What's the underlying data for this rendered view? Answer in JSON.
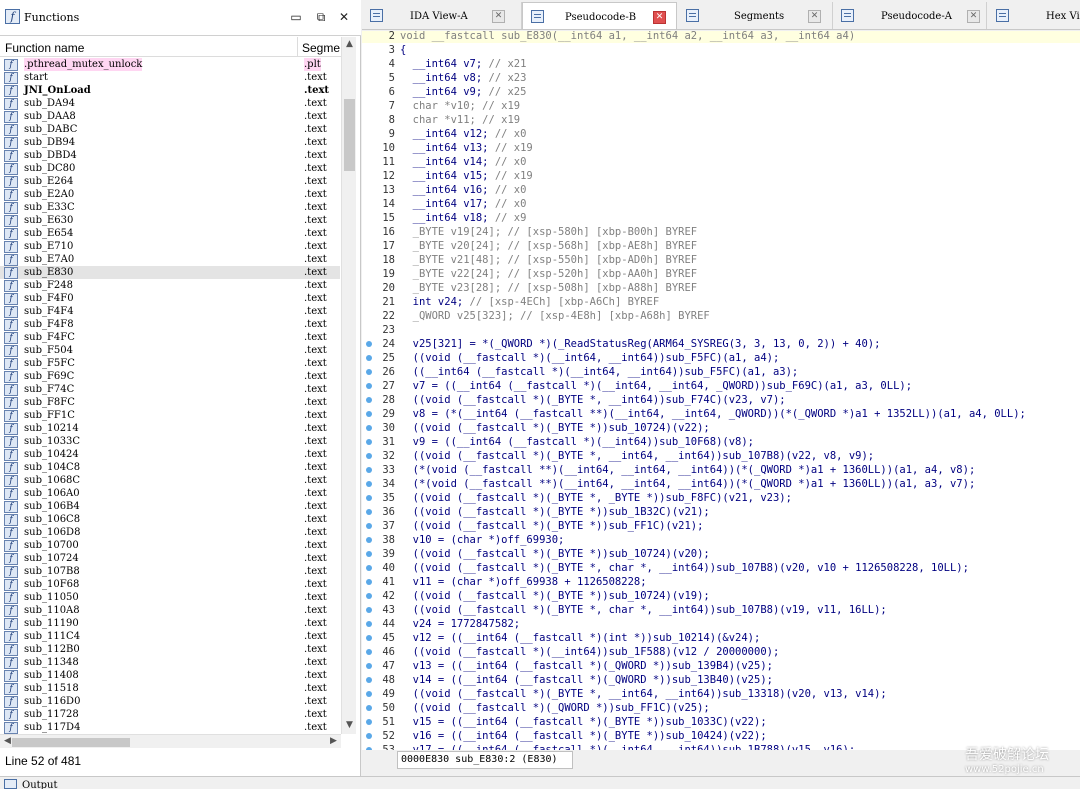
{
  "functions_panel": {
    "title": "Functions",
    "col_name": "Function name",
    "col_segment": "Segme",
    "status": "Line 52 of 481",
    "rows": [
      {
        "name": ".pthread_mutex_unlock",
        "seg": ".plt",
        "style": "pink"
      },
      {
        "name": "start",
        "seg": ".text",
        "style": ""
      },
      {
        "name": "JNI_OnLoad",
        "seg": ".text",
        "style": "bold"
      },
      {
        "name": "sub_DA94",
        "seg": ".text",
        "style": ""
      },
      {
        "name": "sub_DAA8",
        "seg": ".text",
        "style": ""
      },
      {
        "name": "sub_DABC",
        "seg": ".text",
        "style": ""
      },
      {
        "name": "sub_DB94",
        "seg": ".text",
        "style": ""
      },
      {
        "name": "sub_DBD4",
        "seg": ".text",
        "style": ""
      },
      {
        "name": "sub_DC80",
        "seg": ".text",
        "style": ""
      },
      {
        "name": "sub_E264",
        "seg": ".text",
        "style": ""
      },
      {
        "name": "sub_E2A0",
        "seg": ".text",
        "style": ""
      },
      {
        "name": "sub_E33C",
        "seg": ".text",
        "style": ""
      },
      {
        "name": "sub_E630",
        "seg": ".text",
        "style": ""
      },
      {
        "name": "sub_E654",
        "seg": ".text",
        "style": ""
      },
      {
        "name": "sub_E710",
        "seg": ".text",
        "style": ""
      },
      {
        "name": "sub_E7A0",
        "seg": ".text",
        "style": ""
      },
      {
        "name": "sub_E830",
        "seg": ".text",
        "style": "selected"
      },
      {
        "name": "sub_F248",
        "seg": ".text",
        "style": ""
      },
      {
        "name": "sub_F4F0",
        "seg": ".text",
        "style": ""
      },
      {
        "name": "sub_F4F4",
        "seg": ".text",
        "style": ""
      },
      {
        "name": "sub_F4F8",
        "seg": ".text",
        "style": ""
      },
      {
        "name": "sub_F4FC",
        "seg": ".text",
        "style": ""
      },
      {
        "name": "sub_F504",
        "seg": ".text",
        "style": ""
      },
      {
        "name": "sub_F5FC",
        "seg": ".text",
        "style": ""
      },
      {
        "name": "sub_F69C",
        "seg": ".text",
        "style": ""
      },
      {
        "name": "sub_F74C",
        "seg": ".text",
        "style": ""
      },
      {
        "name": "sub_F8FC",
        "seg": ".text",
        "style": ""
      },
      {
        "name": "sub_FF1C",
        "seg": ".text",
        "style": ""
      },
      {
        "name": "sub_10214",
        "seg": ".text",
        "style": ""
      },
      {
        "name": "sub_1033C",
        "seg": ".text",
        "style": ""
      },
      {
        "name": "sub_10424",
        "seg": ".text",
        "style": ""
      },
      {
        "name": "sub_104C8",
        "seg": ".text",
        "style": ""
      },
      {
        "name": "sub_1068C",
        "seg": ".text",
        "style": ""
      },
      {
        "name": "sub_106A0",
        "seg": ".text",
        "style": ""
      },
      {
        "name": "sub_106B4",
        "seg": ".text",
        "style": ""
      },
      {
        "name": "sub_106C8",
        "seg": ".text",
        "style": ""
      },
      {
        "name": "sub_106D8",
        "seg": ".text",
        "style": ""
      },
      {
        "name": "sub_10700",
        "seg": ".text",
        "style": ""
      },
      {
        "name": "sub_10724",
        "seg": ".text",
        "style": ""
      },
      {
        "name": "sub_107B8",
        "seg": ".text",
        "style": ""
      },
      {
        "name": "sub_10F68",
        "seg": ".text",
        "style": ""
      },
      {
        "name": "sub_11050",
        "seg": ".text",
        "style": ""
      },
      {
        "name": "sub_110A8",
        "seg": ".text",
        "style": ""
      },
      {
        "name": "sub_11190",
        "seg": ".text",
        "style": ""
      },
      {
        "name": "sub_111C4",
        "seg": ".text",
        "style": ""
      },
      {
        "name": "sub_112B0",
        "seg": ".text",
        "style": ""
      },
      {
        "name": "sub_11348",
        "seg": ".text",
        "style": ""
      },
      {
        "name": "sub_11408",
        "seg": ".text",
        "style": ""
      },
      {
        "name": "sub_11518",
        "seg": ".text",
        "style": ""
      },
      {
        "name": "sub_116D0",
        "seg": ".text",
        "style": ""
      },
      {
        "name": "sub_11728",
        "seg": ".text",
        "style": ""
      },
      {
        "name": "sub_117D4",
        "seg": ".text",
        "style": ""
      }
    ]
  },
  "tabs": [
    {
      "label": "IDA View-A",
      "active": false
    },
    {
      "label": "Pseudocode-B",
      "active": true
    },
    {
      "label": "Segments",
      "active": false
    },
    {
      "label": "Pseudocode-A",
      "active": false
    },
    {
      "label": "Hex Vi",
      "active": false
    }
  ],
  "code": {
    "status": "0000E830 sub_E830:2 (E830)",
    "lines": [
      {
        "n": "2",
        "dot": false,
        "t": "void __fastcall sub_E830(__int64 a1, __int64 a2, __int64 a3, __int64 a4)",
        "c": ""
      },
      {
        "n": "3",
        "dot": false,
        "t": "{",
        "c": ""
      },
      {
        "n": "4",
        "dot": false,
        "t": "  __int64 v7; ",
        "c": "// x21"
      },
      {
        "n": "5",
        "dot": false,
        "t": "  __int64 v8; ",
        "c": "// x23"
      },
      {
        "n": "6",
        "dot": false,
        "t": "  __int64 v9; ",
        "c": "// x25"
      },
      {
        "n": "7",
        "dot": false,
        "t": "",
        "c": "  char *v10; // x19"
      },
      {
        "n": "8",
        "dot": false,
        "t": "",
        "c": "  char *v11; // x19"
      },
      {
        "n": "9",
        "dot": false,
        "t": "  __int64 v12; ",
        "c": "// x0"
      },
      {
        "n": "10",
        "dot": false,
        "t": "  __int64 v13; ",
        "c": "// x19"
      },
      {
        "n": "11",
        "dot": false,
        "t": "  __int64 v14; ",
        "c": "// x0"
      },
      {
        "n": "12",
        "dot": false,
        "t": "  __int64 v15; ",
        "c": "// x19"
      },
      {
        "n": "13",
        "dot": false,
        "t": "  __int64 v16; ",
        "c": "// x0"
      },
      {
        "n": "14",
        "dot": false,
        "t": "  __int64 v17; ",
        "c": "// x0"
      },
      {
        "n": "15",
        "dot": false,
        "t": "  __int64 v18; ",
        "c": "// x9"
      },
      {
        "n": "16",
        "dot": false,
        "t": "",
        "c": "  _BYTE v19[24]; // [xsp-580h] [xbp-B00h] BYREF"
      },
      {
        "n": "17",
        "dot": false,
        "t": "",
        "c": "  _BYTE v20[24]; // [xsp-568h] [xbp-AE8h] BYREF"
      },
      {
        "n": "18",
        "dot": false,
        "t": "",
        "c": "  _BYTE v21[48]; // [xsp-550h] [xbp-AD0h] BYREF"
      },
      {
        "n": "19",
        "dot": false,
        "t": "",
        "c": "  _BYTE v22[24]; // [xsp-520h] [xbp-AA0h] BYREF"
      },
      {
        "n": "20",
        "dot": false,
        "t": "",
        "c": "  _BYTE v23[28]; // [xsp-508h] [xbp-A88h] BYREF"
      },
      {
        "n": "21",
        "dot": false,
        "t": "  int v24; ",
        "c": "// [xsp-4ECh] [xbp-A6Ch] BYREF"
      },
      {
        "n": "22",
        "dot": false,
        "t": "",
        "c": "  _QWORD v25[323]; // [xsp-4E8h] [xbp-A68h] BYREF"
      },
      {
        "n": "23",
        "dot": false,
        "t": "",
        "c": ""
      },
      {
        "n": "24",
        "dot": true,
        "t": "  v25[321] = *(_QWORD *)(_ReadStatusReg(ARM64_SYSREG(3, 3, 13, 0, 2)) + 40);",
        "c": ""
      },
      {
        "n": "25",
        "dot": true,
        "t": "  ((void (__fastcall *)(__int64, __int64))sub_F5FC)(a1, a4);",
        "c": ""
      },
      {
        "n": "26",
        "dot": true,
        "t": "  ((__int64 (__fastcall *)(__int64, __int64))sub_F5FC)(a1, a3);",
        "c": ""
      },
      {
        "n": "27",
        "dot": true,
        "t": "  v7 = ((__int64 (__fastcall *)(__int64, __int64, _QWORD))sub_F69C)(a1, a3, 0LL);",
        "c": ""
      },
      {
        "n": "28",
        "dot": true,
        "t": "  ((void (__fastcall *)(_BYTE *, __int64))sub_F74C)(v23, v7);",
        "c": ""
      },
      {
        "n": "29",
        "dot": true,
        "t": "  v8 = (*(__int64 (__fastcall **)(__int64, __int64, _QWORD))(*(_QWORD *)a1 + 1352LL))(a1, a4, 0LL);",
        "c": ""
      },
      {
        "n": "30",
        "dot": true,
        "t": "  ((void (__fastcall *)(_BYTE *))sub_10724)(v22);",
        "c": ""
      },
      {
        "n": "31",
        "dot": true,
        "t": "  v9 = ((__int64 (__fastcall *)(__int64))sub_10F68)(v8);",
        "c": ""
      },
      {
        "n": "32",
        "dot": true,
        "t": "  ((void (__fastcall *)(_BYTE *, __int64, __int64))sub_107B8)(v22, v8, v9);",
        "c": ""
      },
      {
        "n": "33",
        "dot": true,
        "t": "  (*(void (__fastcall **)(__int64, __int64, __int64))(*(_QWORD *)a1 + 1360LL))(a1, a4, v8);",
        "c": ""
      },
      {
        "n": "34",
        "dot": true,
        "t": "  (*(void (__fastcall **)(__int64, __int64, __int64))(*(_QWORD *)a1 + 1360LL))(a1, a3, v7);",
        "c": ""
      },
      {
        "n": "35",
        "dot": true,
        "t": "  ((void (__fastcall *)(_BYTE *, _BYTE *))sub_F8FC)(v21, v23);",
        "c": ""
      },
      {
        "n": "36",
        "dot": true,
        "t": "  ((void (__fastcall *)(_BYTE *))sub_1B32C)(v21);",
        "c": ""
      },
      {
        "n": "37",
        "dot": true,
        "t": "  ((void (__fastcall *)(_BYTE *))sub_FF1C)(v21);",
        "c": ""
      },
      {
        "n": "38",
        "dot": true,
        "t": "  v10 = (char *)off_69930;",
        "c": ""
      },
      {
        "n": "39",
        "dot": true,
        "t": "  ((void (__fastcall *)(_BYTE *))sub_10724)(v20);",
        "c": ""
      },
      {
        "n": "40",
        "dot": true,
        "t": "  ((void (__fastcall *)(_BYTE *, char *, __int64))sub_107B8)(v20, v10 + 1126508228, 10LL);",
        "c": ""
      },
      {
        "n": "41",
        "dot": true,
        "t": "  v11 = (char *)off_69938 + 1126508228;",
        "c": ""
      },
      {
        "n": "42",
        "dot": true,
        "t": "  ((void (__fastcall *)(_BYTE *))sub_10724)(v19);",
        "c": ""
      },
      {
        "n": "43",
        "dot": true,
        "t": "  ((void (__fastcall *)(_BYTE *, char *, __int64))sub_107B8)(v19, v11, 16LL);",
        "c": ""
      },
      {
        "n": "44",
        "dot": true,
        "t": "  v24 = 1772847582;",
        "c": ""
      },
      {
        "n": "45",
        "dot": true,
        "t": "  v12 = ((__int64 (__fastcall *)(int *))sub_10214)(&v24);",
        "c": ""
      },
      {
        "n": "46",
        "dot": true,
        "t": "  ((void (__fastcall *)(__int64))sub_1F588)(v12 / 20000000);",
        "c": ""
      },
      {
        "n": "47",
        "dot": true,
        "t": "  v13 = ((__int64 (__fastcall *)(_QWORD *))sub_139B4)(v25);",
        "c": ""
      },
      {
        "n": "48",
        "dot": true,
        "t": "  v14 = ((__int64 (__fastcall *)(_QWORD *))sub_13B40)(v25);",
        "c": ""
      },
      {
        "n": "49",
        "dot": true,
        "t": "  ((void (__fastcall *)(_BYTE *, __int64, __int64))sub_13318)(v20, v13, v14);",
        "c": ""
      },
      {
        "n": "50",
        "dot": true,
        "t": "  ((void (__fastcall *)(_QWORD *))sub_FF1C)(v25);",
        "c": ""
      },
      {
        "n": "51",
        "dot": true,
        "t": "  v15 = ((__int64 (__fastcall *)(_BYTE *))sub_1033C)(v22);",
        "c": ""
      },
      {
        "n": "52",
        "dot": true,
        "t": "  v16 = ((__int64 (__fastcall *)(_BYTE *))sub_10424)(v22);",
        "c": ""
      },
      {
        "n": "53",
        "dot": true,
        "t": "  v17 = ((__int64 (__fastcall *)(__int64, __int64))sub_1B788)(v15, v16);",
        "c": ""
      }
    ]
  },
  "output": {
    "label": "Output"
  },
  "watermark": {
    "line1": "吾爱破解论坛",
    "line2": "www.52pojie.cn"
  }
}
